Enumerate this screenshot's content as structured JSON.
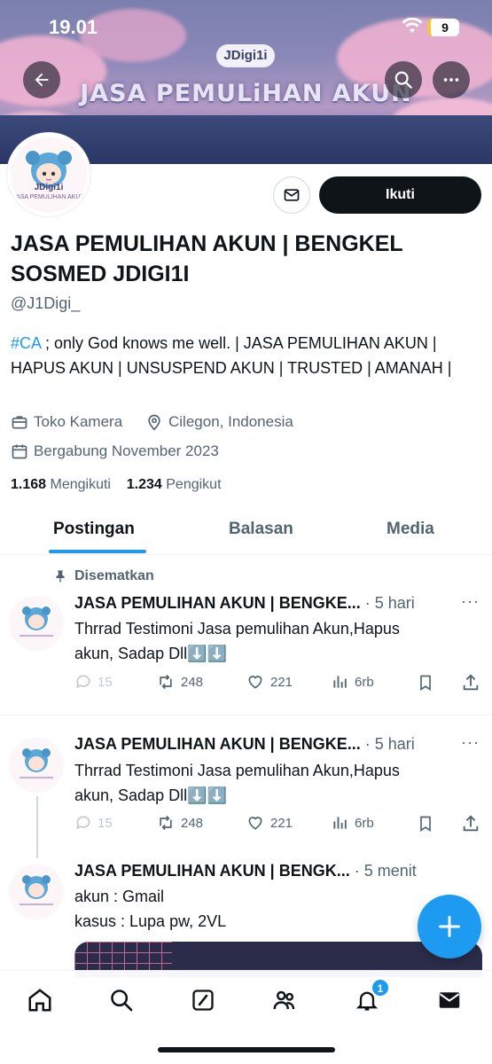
{
  "status_bar": {
    "time": "19.01",
    "battery": "9"
  },
  "banner": {
    "badge": "JDigi1i",
    "title": "JASA PEMULiHAN AKUN",
    "icons": [
      "back-arrow-icon",
      "search-icon",
      "more-icon"
    ]
  },
  "avatar": {
    "brand": "JDigi1i",
    "caption": "JASA PEMULIHAN AKUN"
  },
  "profile": {
    "follow_label": "Ikuti",
    "name_line1": "JASA PEMULIHAN AKUN | BENGKEL",
    "name_line2": "SOSMED JDIGI1I",
    "handle": "@J1Digi_",
    "bio_hashtag": "#CA",
    "bio_rest": " ; only God knows me well. | JASA PEMULIHAN AKUN | HAPUS AKUN | UNSUSPEND AKUN | TRUSTED | AMANAH |",
    "category": "Toko Kamera",
    "location": "Cilegon, Indonesia",
    "joined": "Bergabung November 2023",
    "following_count": "1.168",
    "following_label": " Mengikuti",
    "followers_count": "1.234",
    "followers_label": " Pengikut"
  },
  "tabs": [
    {
      "label": "Postingan",
      "active": true
    },
    {
      "label": "Balasan",
      "active": false
    },
    {
      "label": "Media",
      "active": false
    }
  ],
  "posts": [
    {
      "pinned_label": "Disematkan",
      "author": "JASA PEMULIHAN AKUN | BENGKE...",
      "time": "· 5 hari",
      "text_line1": "Thrrad Testimoni Jasa pemulihan Akun,Hapus",
      "text_line2": "akun, Sadap Dll⬇️⬇️",
      "replies": "15",
      "reposts": "248",
      "likes": "221",
      "views": "6rb"
    },
    {
      "author": "JASA PEMULIHAN AKUN | BENGKE...",
      "time": "· 5 hari",
      "text_line1": "Thrrad Testimoni Jasa pemulihan Akun,Hapus",
      "text_line2": "akun, Sadap Dll⬇️⬇️",
      "replies": "15",
      "reposts": "248",
      "likes": "221",
      "views": "6rb"
    },
    {
      "author": "JASA PEMULIHAN AKUN | BENGK...",
      "time": "· 5 menit",
      "text_line1": "akun : Gmail",
      "text_line2": "kasus : Lupa pw, 2VL"
    }
  ],
  "bottom_nav": {
    "notification_badge": "1"
  },
  "colors": {
    "accent": "#1d9bf0",
    "text": "#0f1419",
    "muted": "#536471"
  }
}
